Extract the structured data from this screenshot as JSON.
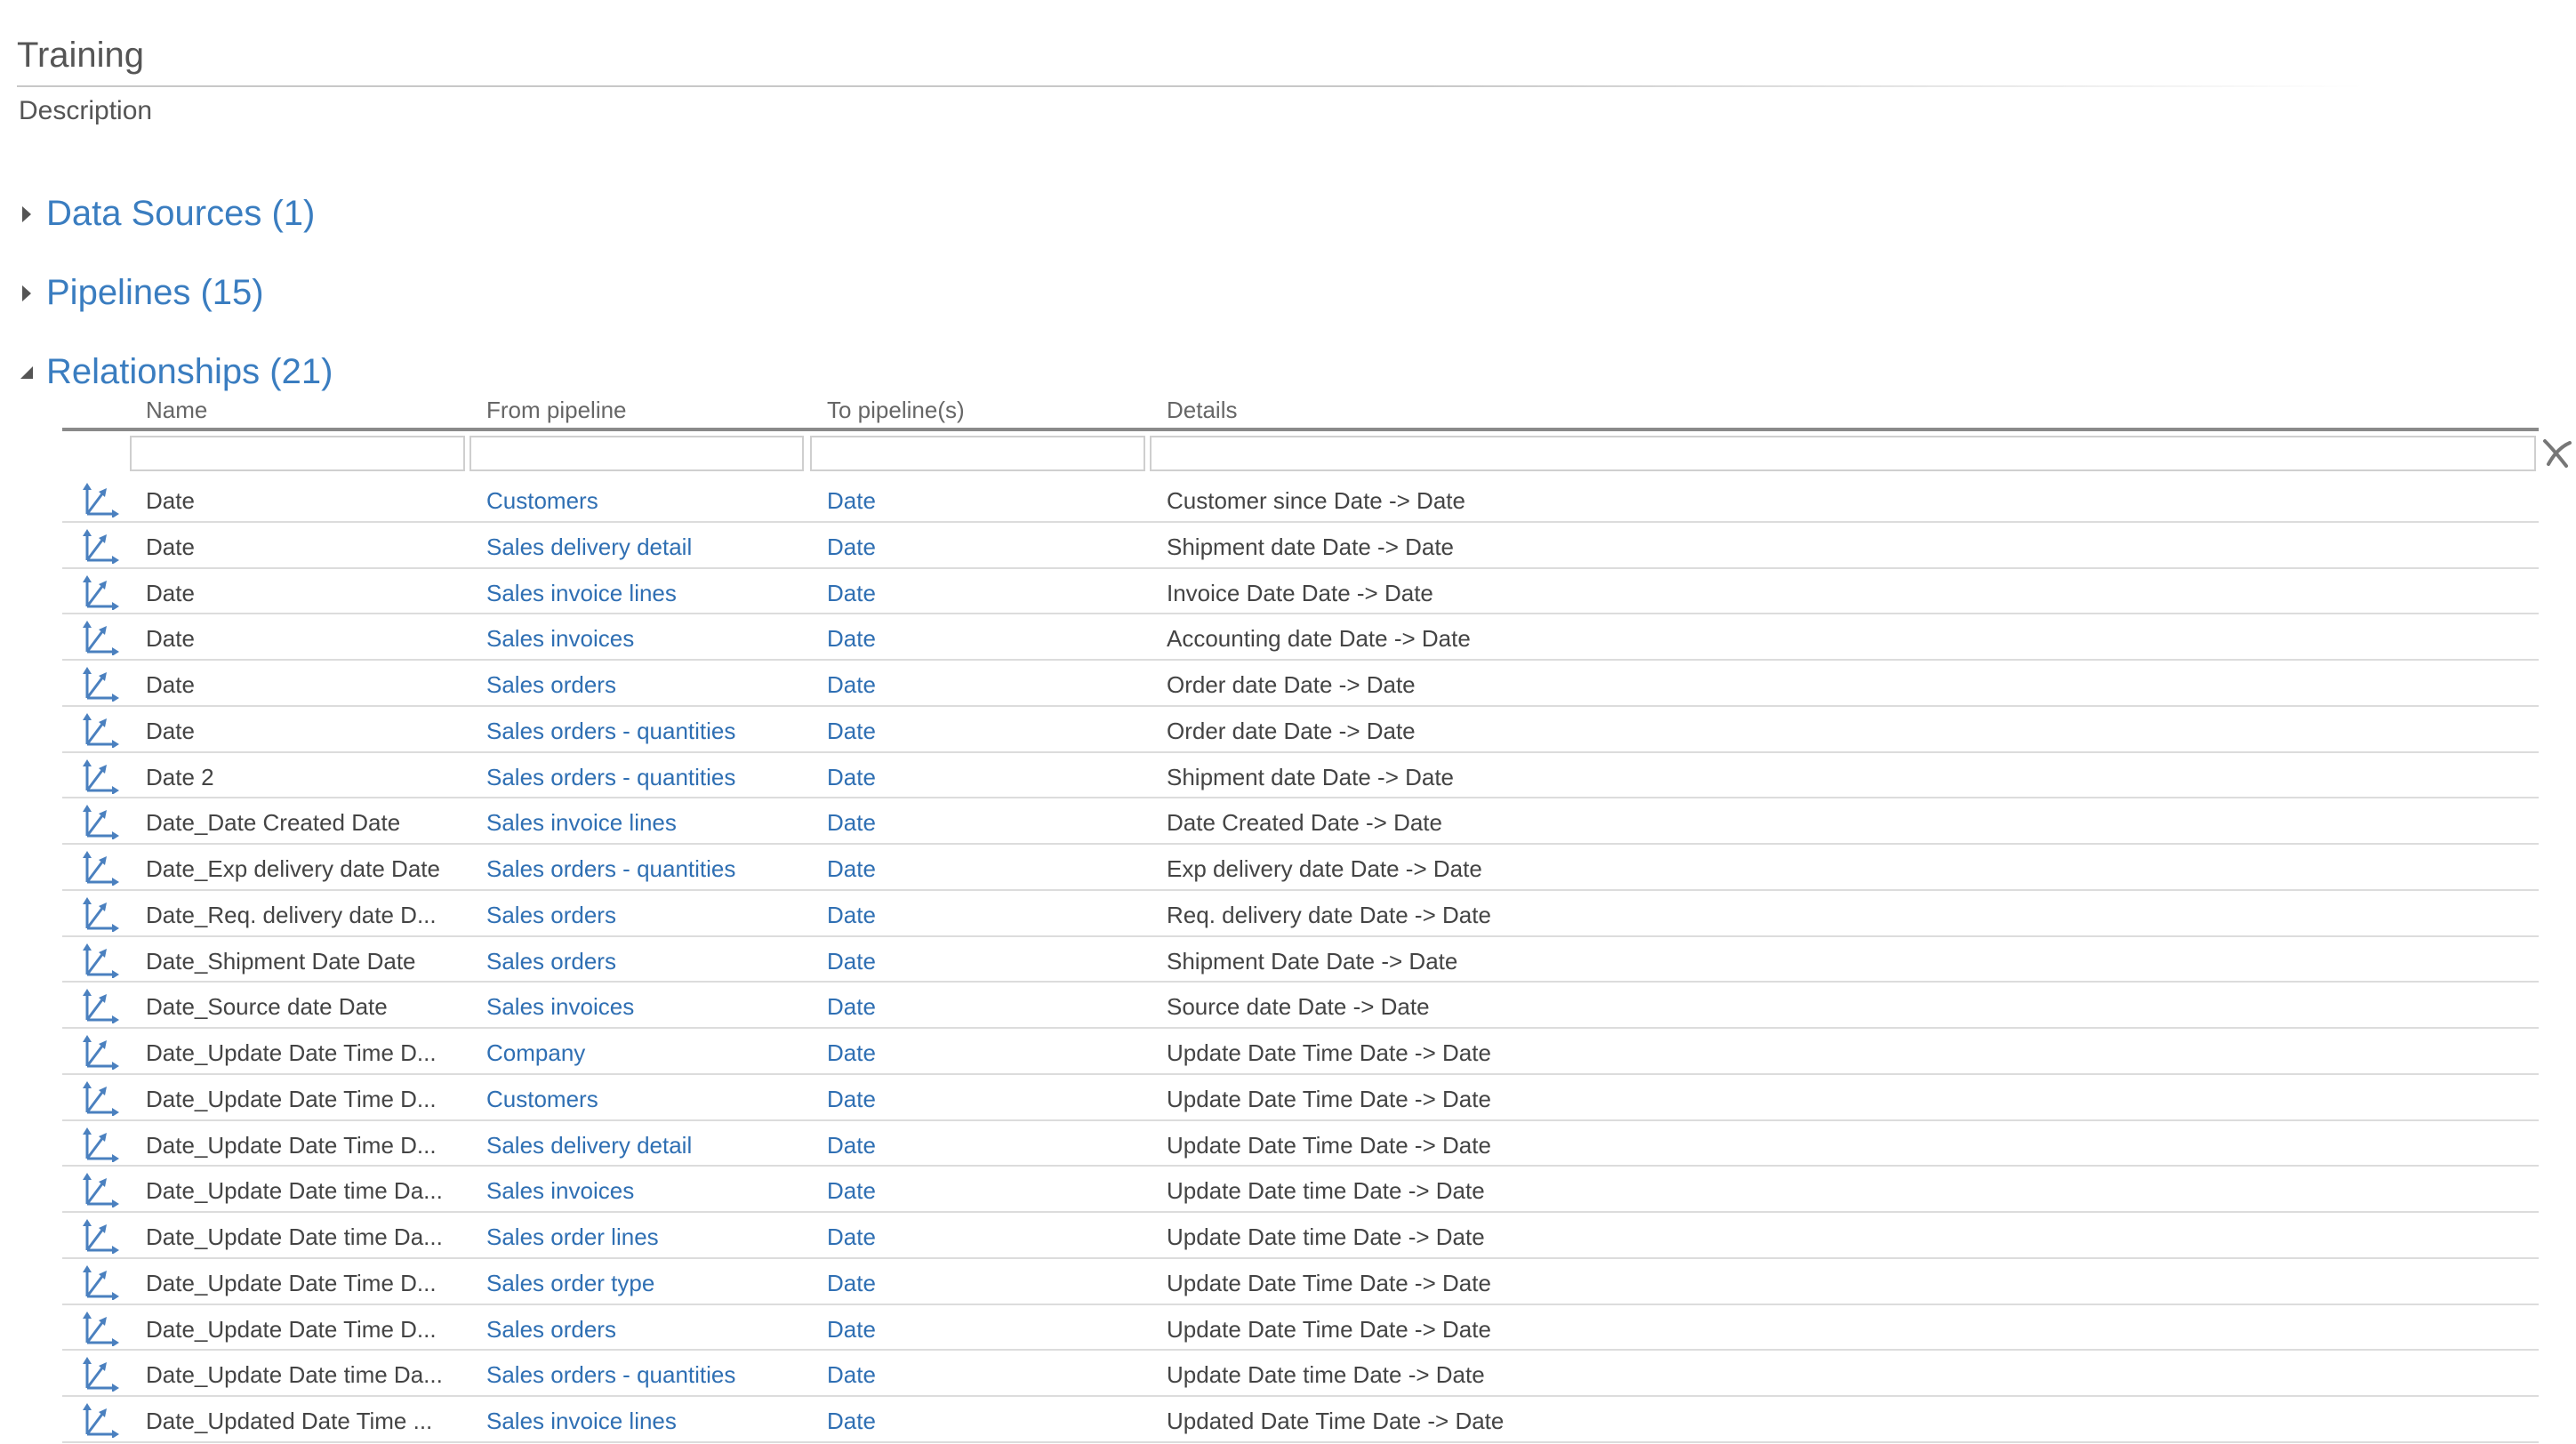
{
  "page": {
    "title": "Training",
    "description": "Description"
  },
  "sections": [
    {
      "label": "Data Sources (1)",
      "expanded": false
    },
    {
      "label": "Pipelines (15)",
      "expanded": false
    },
    {
      "label": "Relationships (21)",
      "expanded": true
    }
  ],
  "table": {
    "columns": [
      "Name",
      "From pipeline",
      "To pipeline(s)",
      "Details"
    ],
    "rows": [
      [
        "Date",
        "Customers",
        "Date",
        "Customer since Date -> Date"
      ],
      [
        "Date",
        "Sales delivery detail",
        "Date",
        "Shipment date Date -> Date"
      ],
      [
        "Date",
        "Sales invoice lines",
        "Date",
        "Invoice Date Date -> Date"
      ],
      [
        "Date",
        "Sales invoices",
        "Date",
        "Accounting date Date -> Date"
      ],
      [
        "Date",
        "Sales orders",
        "Date",
        "Order date Date -> Date"
      ],
      [
        "Date",
        "Sales orders - quantities",
        "Date",
        "Order date Date -> Date"
      ],
      [
        "Date 2",
        "Sales orders - quantities",
        "Date",
        "Shipment date Date -> Date"
      ],
      [
        "Date_Date Created Date",
        "Sales invoice lines",
        "Date",
        "Date Created Date -> Date"
      ],
      [
        "Date_Exp delivery date Date",
        "Sales orders - quantities",
        "Date",
        "Exp delivery date Date -> Date"
      ],
      [
        "Date_Req. delivery date D...",
        "Sales orders",
        "Date",
        "Req. delivery date Date -> Date"
      ],
      [
        "Date_Shipment Date Date",
        "Sales orders",
        "Date",
        "Shipment Date Date -> Date"
      ],
      [
        "Date_Source date Date",
        "Sales invoices",
        "Date",
        "Source date Date -> Date"
      ],
      [
        "Date_Update Date Time D...",
        "Company",
        "Date",
        "Update Date Time Date -> Date"
      ],
      [
        "Date_Update Date Time D...",
        "Customers",
        "Date",
        "Update Date Time Date -> Date"
      ],
      [
        "Date_Update Date Time D...",
        "Sales delivery detail",
        "Date",
        "Update Date Time Date -> Date"
      ],
      [
        "Date_Update Date time Da...",
        "Sales invoices",
        "Date",
        "Update Date time Date -> Date"
      ],
      [
        "Date_Update Date time Da...",
        "Sales order lines",
        "Date",
        "Update Date time Date -> Date"
      ],
      [
        "Date_Update Date Time D...",
        "Sales order type",
        "Date",
        "Update Date Time Date -> Date"
      ],
      [
        "Date_Update Date Time D...",
        "Sales orders",
        "Date",
        "Update Date Time Date -> Date"
      ],
      [
        "Date_Update Date time Da...",
        "Sales orders - quantities",
        "Date",
        "Update Date time Date -> Date"
      ],
      [
        "Date_Updated Date Time ...",
        "Sales invoice lines",
        "Date",
        "Updated Date Time Date -> Date"
      ]
    ]
  },
  "colors": {
    "accent": "#3a7dc0",
    "link": "#2f6fb3",
    "icon": "#4a80bf"
  }
}
